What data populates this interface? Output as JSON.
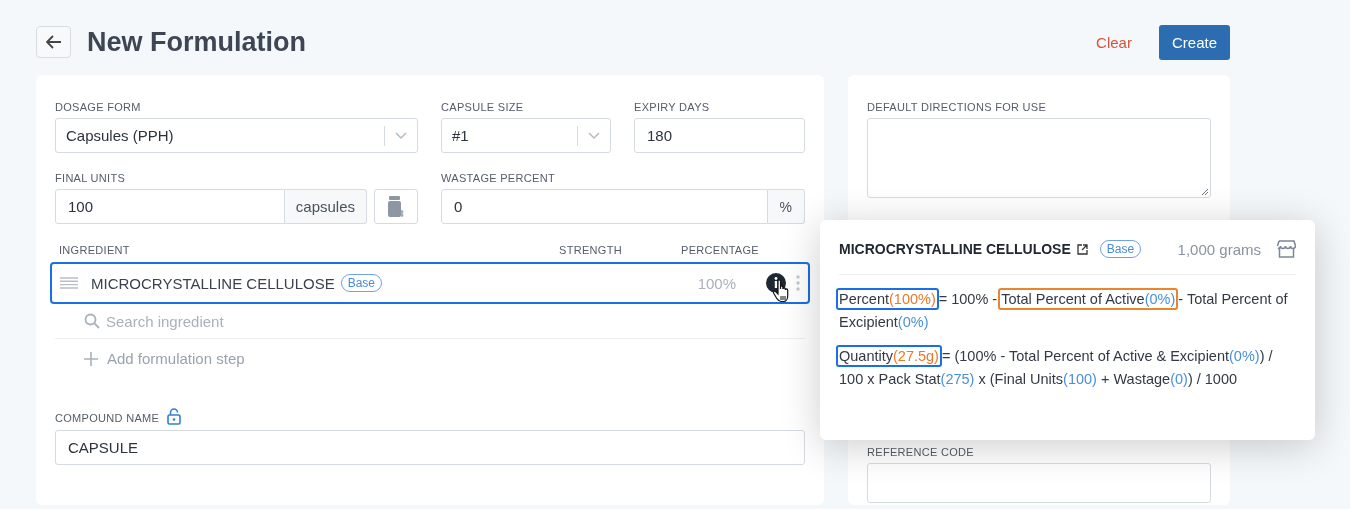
{
  "header": {
    "title": "New Formulation",
    "clear_label": "Clear",
    "create_label": "Create"
  },
  "form": {
    "dosage_form": {
      "label": "DOSAGE FORM",
      "value": "Capsules (PPH)"
    },
    "capsule_size": {
      "label": "CAPSULE SIZE",
      "value": "#1"
    },
    "expiry_days": {
      "label": "EXPIRY DAYS",
      "value": "180"
    },
    "final_units": {
      "label": "FINAL UNITS",
      "value": "100",
      "unit": "capsules"
    },
    "wastage_percent": {
      "label": "WASTAGE PERCENT",
      "value": "0",
      "unit": "%"
    }
  },
  "ingredients": {
    "columns": [
      "INGREDIENT",
      "STRENGTH",
      "PERCENTAGE"
    ],
    "rows": [
      {
        "name": "MICROCRYSTALLINE CELLULOSE",
        "badge": "Base",
        "percentage": "100%",
        "selected": true
      }
    ],
    "search_placeholder": "Search ingredient",
    "add_step_label": "Add formulation step"
  },
  "compound_name": {
    "label": "COMPOUND NAME",
    "value": "CAPSULE",
    "locked": false
  },
  "side": {
    "directions_label": "DEFAULT DIRECTIONS FOR USE",
    "reference_label": "REFERENCE CODE"
  },
  "popover": {
    "title": "MICROCRYSTALLINE CELLULOSE",
    "badge": "Base",
    "amount": "1,000 grams",
    "formulas": [
      [
        {
          "text": "Percent",
          "value": "(100%)",
          "kind": "result",
          "color": "#1a6ee6"
        },
        {
          "text": "= 100% - "
        },
        {
          "text": "Total Percent of Active",
          "value": "(0%)",
          "kind": "input",
          "color": "#e8852e"
        },
        {
          "text": "- Total Percent of Excipient",
          "value": "(0%)",
          "kind": "input"
        }
      ],
      [
        {
          "text": "Quantity",
          "value": "(27.5g)",
          "kind": "result",
          "color": "#1a6ee6"
        },
        {
          "text": "= (100% - Total Percent of Active & Excipient",
          "value": "(0%)",
          "kind": "input"
        },
        {
          "text": ") / 100 x Pack Stat",
          "value": "(275)",
          "kind": "input"
        },
        {
          "text": " x (Final Units",
          "value": "(100)",
          "kind": "input"
        },
        {
          "text": " + Wastage",
          "value": "(0)",
          "kind": "input"
        },
        {
          "text": ") / 1000"
        }
      ]
    ]
  }
}
